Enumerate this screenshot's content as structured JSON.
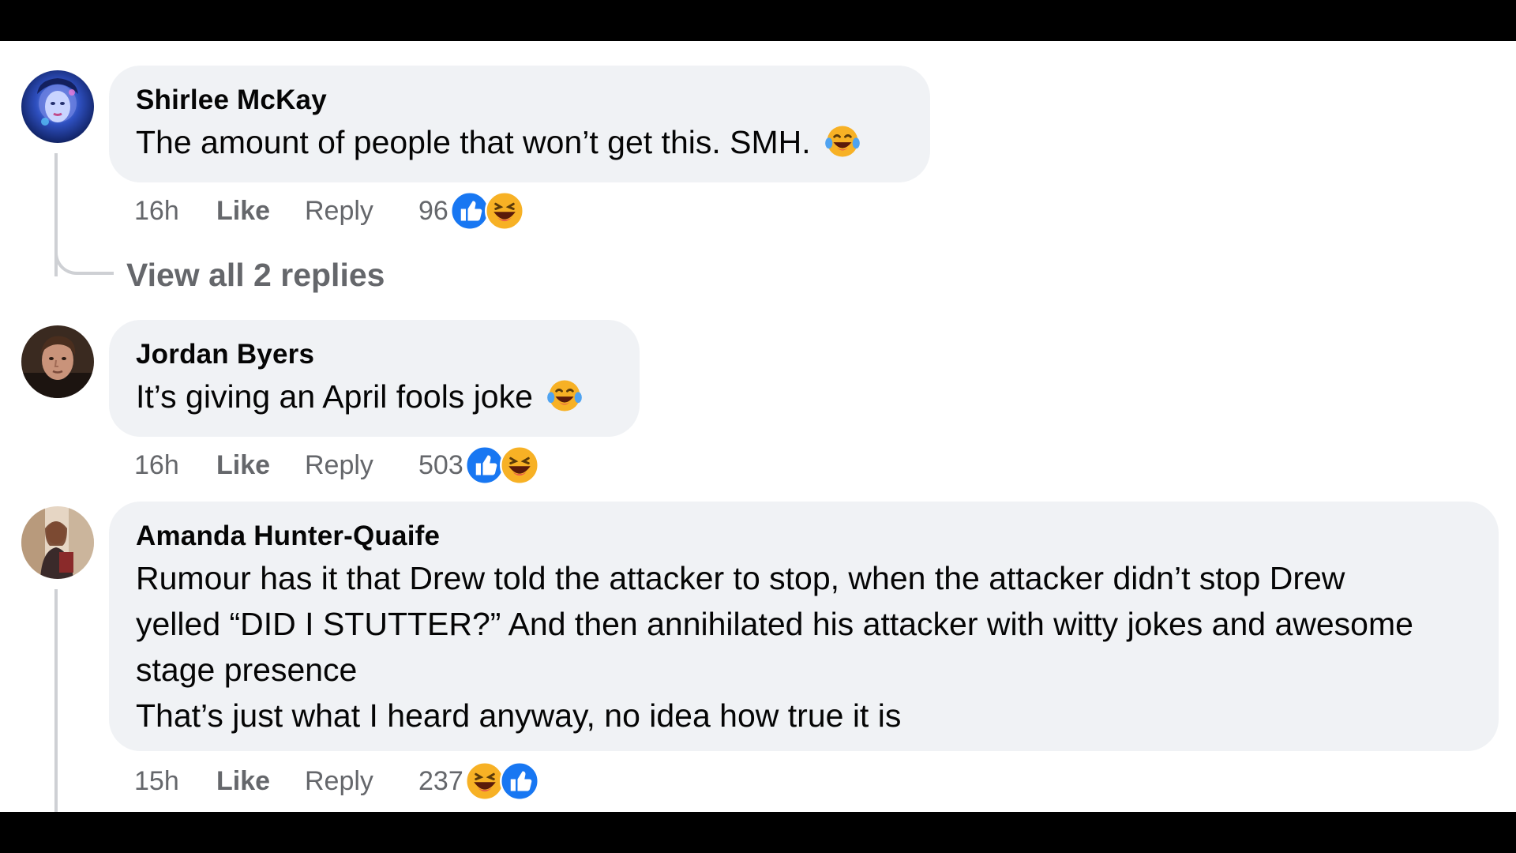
{
  "comments": [
    {
      "author": "Shirlee McKay",
      "text": "The amount of people that won’t get this. SMH.",
      "inline_emoji": "laugh-cry",
      "time": "16h",
      "like_label": "Like",
      "reply_label": "Reply",
      "reaction_count": "96",
      "reactions": [
        "like",
        "haha"
      ],
      "view_replies": "View all 2 replies"
    },
    {
      "author": "Jordan Byers",
      "text": "It’s giving an April fools joke",
      "inline_emoji": "laugh-cry",
      "time": "16h",
      "like_label": "Like",
      "reply_label": "Reply",
      "reaction_count": "503",
      "reactions": [
        "like",
        "haha"
      ]
    },
    {
      "author": "Amanda Hunter-Quaife",
      "text_lines": [
        "Rumour has it that Drew told the attacker to stop, when the attacker didn’t stop Drew",
        "yelled “DID I STUTTER?” And then annihilated his attacker with witty jokes and awesome",
        "stage presence",
        "That’s just what I heard anyway, no idea how true it is"
      ],
      "time": "15h",
      "like_label": "Like",
      "reply_label": "Reply",
      "reaction_count": "237",
      "reactions": [
        "haha",
        "like"
      ]
    }
  ],
  "colors": {
    "bubble": "#f0f2f5",
    "secondary_text": "#65676b",
    "like_blue": "#1877f2",
    "haha_yellow": "#f7b125"
  }
}
